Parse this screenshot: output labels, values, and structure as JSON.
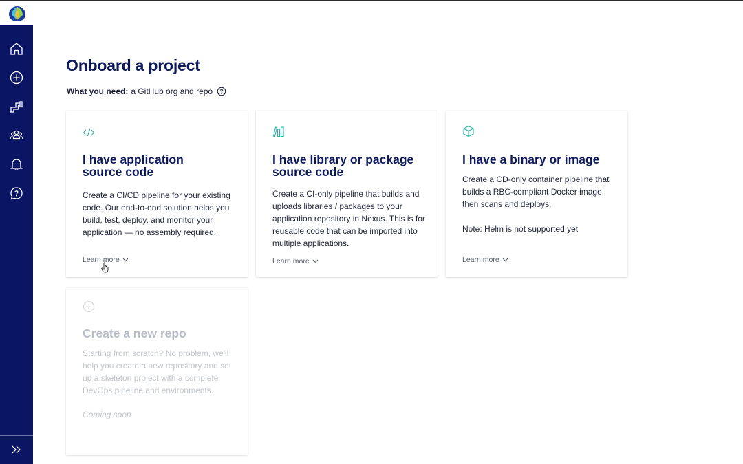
{
  "app": {
    "logo": "app-logo"
  },
  "sidebar": {
    "items": [
      {
        "name": "home",
        "icon": "home-icon"
      },
      {
        "name": "create",
        "icon": "plus-circle-icon"
      },
      {
        "name": "pipelines",
        "icon": "pipeline-icon"
      },
      {
        "name": "teams",
        "icon": "users-icon"
      },
      {
        "name": "notifications",
        "icon": "bell-icon"
      },
      {
        "name": "support",
        "icon": "help-chat-icon"
      }
    ],
    "expand_icon": "chevrons-right-icon",
    "colors": {
      "background": "#0a1664",
      "icon": "#ffffff"
    }
  },
  "page": {
    "title": "Onboard a project",
    "need_label": "What you need:",
    "need_value": "a GitHub org and repo"
  },
  "cards": [
    {
      "icon": "code-icon",
      "title_line1": "I have application",
      "title_line2": "source code",
      "desc": "Create a CI/CD pipeline for your existing code. Our end-to-end solution helps you build, test, deploy, and monitor your application — no assembly required.",
      "learn_more": "Learn more"
    },
    {
      "icon": "library-icon",
      "title_line1": "I have library or package",
      "title_line2": "source code",
      "desc": "Create a CI-only pipeline that builds and uploads libraries / packages to your application repository in Nexus. This is for reusable code that can be imported into multiple applications.",
      "learn_more": "Learn more"
    },
    {
      "icon": "box-icon",
      "title_line1": "I have a binary or image",
      "desc": "Create a CD-only container pipeline that builds a RBC-compliant Docker image, then scans and deploys.",
      "note": "Note: Helm is not supported yet",
      "learn_more": "Learn more"
    },
    {
      "icon": "plus-circle-icon",
      "title_line1": "Create a new repo",
      "desc": "Starting from scratch? No problem, we'll help you create a new repository and set up a skeleton project with a complete DevOps pipeline and environments.",
      "status": "Coming soon"
    }
  ],
  "accent_color": "#2bb3a8"
}
